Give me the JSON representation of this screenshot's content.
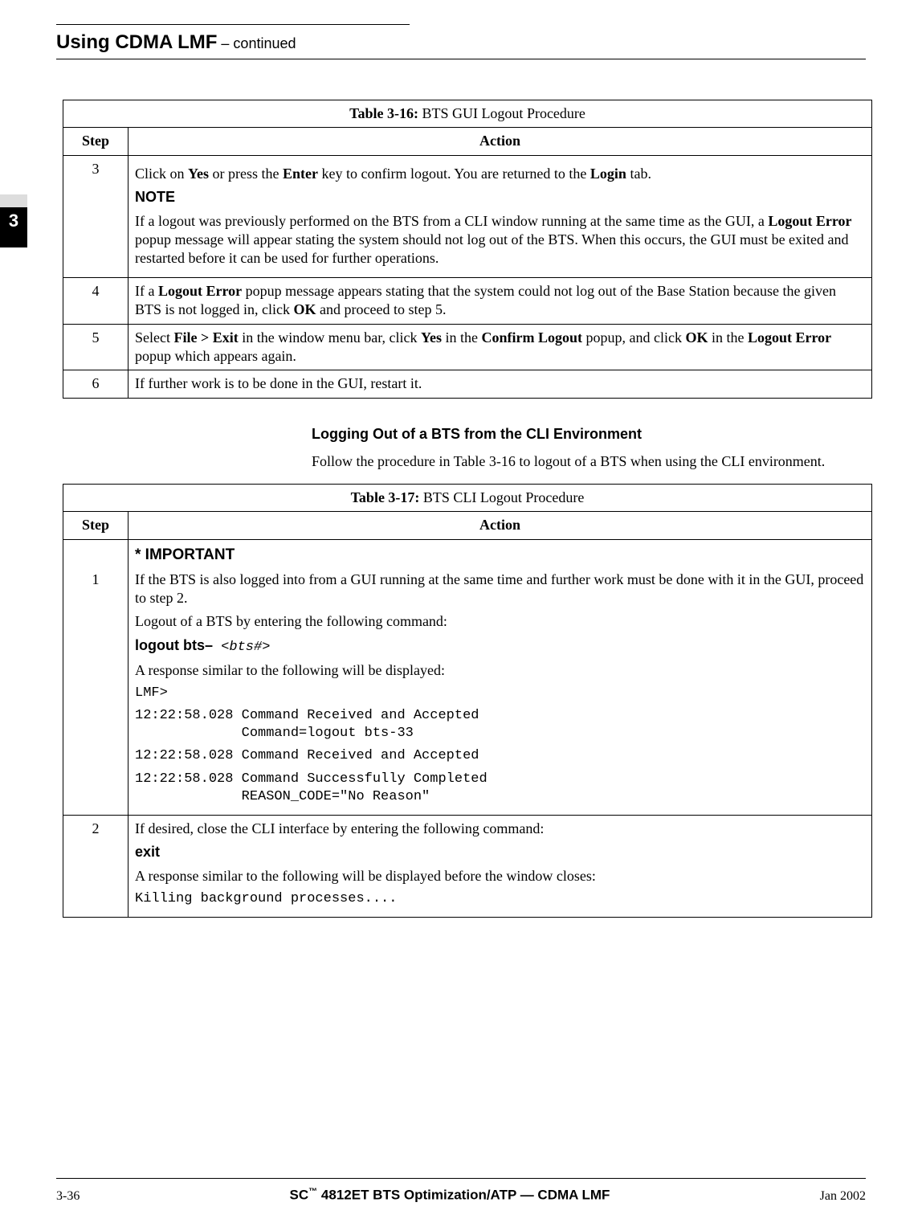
{
  "header": {
    "title": "Using CDMA LMF",
    "continued": "  – continued"
  },
  "sideTab": "3",
  "table1": {
    "caption_bold": "Table 3-16:",
    "caption_rest": " BTS GUI Logout Procedure",
    "col_step": "Step",
    "col_action": "Action",
    "rows": [
      {
        "step": "3",
        "line1a": "Click on ",
        "line1b": "Yes",
        "line1c": " or press the ",
        "line1d": "Enter",
        "line1e": " key to confirm  logout.  You are returned to the ",
        "line1f": "Login",
        "line1g": " tab.",
        "note_label": "NOTE",
        "note_a": "If a logout was previously performed on the BTS from a CLI window running at the same time as the GUI, a ",
        "note_b": "Logout Error",
        "note_c": " popup message will appear stating the system should not log out of the BTS. When this occurs, the GUI must be exited and restarted before it can be used for further operations."
      },
      {
        "step": "4",
        "a": "If a ",
        "b": "Logout Error",
        "c": " popup message appears stating that the system could not log out of the Base Station because the given BTS is not logged in, click ",
        "d": "OK",
        "e": " and proceed to step 5."
      },
      {
        "step": "5",
        "a": "Select ",
        "b": "File > Exit",
        "c": " in the window menu bar, click ",
        "d": "Yes",
        "e": " in the ",
        "f": "Confirm Logout",
        "g": " popup, and click ",
        "h": "OK",
        "i": " in the ",
        "j": "Logout Error",
        "k": " popup which appears again."
      },
      {
        "step": "6",
        "text": "If further work is to be done in the GUI, restart it."
      }
    ]
  },
  "section": {
    "heading": "Logging Out of a BTS from the CLI Environment",
    "para": "Follow the procedure in Table 3-16 to logout of a BTS when using the CLI environment."
  },
  "table2": {
    "caption_bold": "Table 3-17:",
    "caption_rest": " BTS CLI Logout Procedure",
    "col_step": "Step",
    "col_action": "Action",
    "row1": {
      "step": "1",
      "important": "* IMPORTANT",
      "p1": "If the BTS is also logged into from a GUI running at the same time and further work must be done with it in the GUI, proceed to step 2.",
      "p2": "Logout of a BTS by entering the following command:",
      "cmd1_bold": "logout bts–",
      "cmd1_mono": " <bts#>",
      "p3": "A response similar to the following will be displayed:",
      "mono1": "LMF>",
      "mono2": "12:22:58.028 Command Received and Accepted",
      "mono2b": "             Command=logout bts-33",
      "mono3": "12:22:58.028 Command Received and Accepted",
      "mono4": "12:22:58.028 Command Successfully Completed",
      "mono4b": "             REASON_CODE=\"No Reason\""
    },
    "row2": {
      "step": "2",
      "p1": "If desired, close the CLI interface by entering the following command:",
      "cmd": "exit",
      "p2": "A response similar to the following will be displayed before the window closes:",
      "mono": "Killing background processes...."
    }
  },
  "footer": {
    "left": "3-36",
    "center_a": "SC",
    "center_tm": "™",
    "center_b": "4812ET BTS Optimization/ATP — CDMA LMF",
    "right": "Jan 2002"
  }
}
